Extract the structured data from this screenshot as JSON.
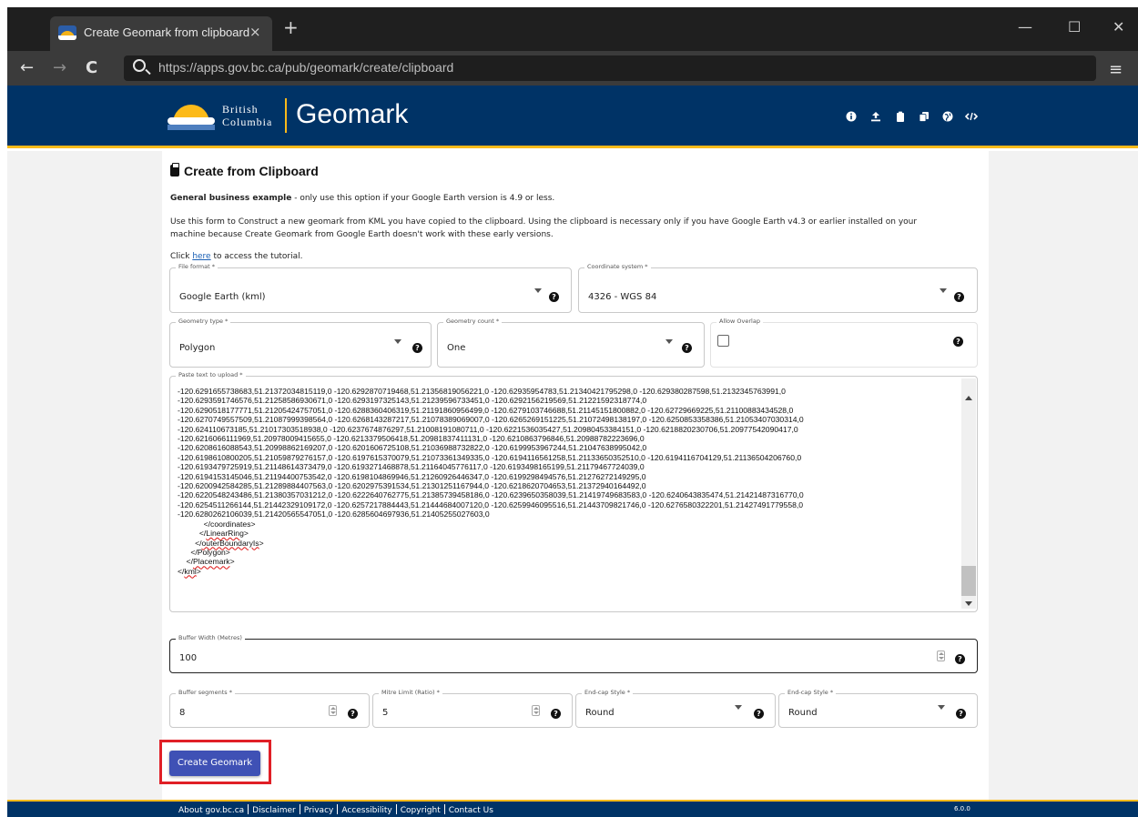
{
  "browser": {
    "tab_title": "Create Geomark from clipboard",
    "tab_close": "×",
    "new_tab": "+",
    "url": "https://apps.gov.bc.ca/pub/geomark/create/clipboard",
    "back": "←",
    "forward": "→",
    "reload": "C",
    "minimize": "—",
    "maximize": "☐",
    "close": "✕",
    "menu": "≡"
  },
  "header": {
    "logo_line1": "British",
    "logo_line2": "Columbia",
    "site_title": "Geomark",
    "icons": [
      "info-icon",
      "upload-icon",
      "clipboard-icon",
      "copy-icon",
      "globe-icon",
      "code-icon"
    ]
  },
  "page": {
    "title": "Create from Clipboard",
    "intro_bold": "General business example",
    "intro_rest": " - only use this option if your Google Earth version is 4.9 or less.",
    "para2_line1": "Use this form to Construct a new geomark from KML you have copied to the clipboard. Using the clipboard is necessary only if you have Google Earth v4.3 or earlier installed on your",
    "para2_line2": "machine because Create Geomark from Google Earth doesn't work with these early versions.",
    "tutorial_pre": "Click ",
    "tutorial_link": "here",
    "tutorial_post": " to access the tutorial."
  },
  "form": {
    "file_format": {
      "label": "File format *",
      "value": "Google Earth (kml)"
    },
    "coordinate_system": {
      "label": "Coordinate system *",
      "value": "4326 - WGS 84"
    },
    "geometry_type": {
      "label": "Geometry type *",
      "value": "Polygon"
    },
    "geometry_count": {
      "label": "Geometry count *",
      "value": "One"
    },
    "allow_overlap": {
      "label": "Allow Overlap"
    },
    "paste": {
      "label": "Paste text to upload *",
      "lines": [
        "-120.6291655738683,51.21372034815119,0 -120.6292870719468,51.21356819056221,0 -120.62935954783,51.21340421795298,0 -120.629380287598,51.2132345763991,0",
        "-120.6293591746576,51.21258586930671,0 -120.6293197325143,51.21239596733451,0 -120.6292156219569,51.21221592318774,0",
        "-120.6290518177771,51.21205424757051,0 -120.6288360406319,51.21191860956499,0 -120.6279103746688,51.21145151800882,0 -120.62729669225,51.21100883434528,0",
        "-120.6270749557509,51.21087999398564,0 -120.6268143287217,51.21078389069007,0 -120.6265269151225,51.21072498138197,0 -120.6250853358386,51.21053407030314,0",
        "-120.624110673185,51.21017303518938,0 -120.6237674876297,51.21008191080711,0 -120.6221536035427,51.20980453384151,0 -120.6218820230706,51.20977542090417,0",
        "-120.6216066111969,51.20978009415655,0 -120.6213379506418,51.20981837411131,0 -120.6210863796846,51.20988782223696,0",
        "-120.6208616088543,51.20998862169207,0 -120.6201606725108,51.21036988732822,0 -120.6199953967244,51.21047638995042,0",
        "-120.6198610800205,51.21059879276157,0 -120.6197615370079,51.21073361349335,0 -120.6194116561258,51.21133650352510,0 -120.6194116704129,51.21136504206760,0",
        "-120.6193479725919,51.21148614373479,0 -120.6193271468878,51.21164045776117,0 -120.6193498165199,51.21179467724039,0",
        "-120.6194153145046,51.21194400753542,0 -120.6198104869946,51.21260926446347,0 -120.6199298494576,51.21276272149295,0",
        "-120.6200942584285,51.21289884407563,0 -120.6202975391534,51.21301251167944,0 -120.6218620704653,51.21372940164492,0",
        "-120.6220548243486,51.21380357031212,0 -120.6222640762775,51.21385739458186,0 -120.6239650358039,51.21419749683583,0 -120.6240643835474,51.21421487316770,0",
        "-120.6254511266144,51.21442329109172,0 -120.6257217884443,51.21444684007120,0 -120.6259946095516,51.21443709821746,0 -120.6276580322201,51.21427491779558,0",
        "-120.6280262106039,51.21420565547051,0 -120.6285604697936,51.21405255027603,0",
        "            </coordinates>",
        "          </LinearRing>",
        "        </outerBoundaryIs>",
        "      </Polygon>",
        "    </Placemark>",
        "</kml>"
      ]
    },
    "buffer_width": {
      "label": "Buffer Width (Metres)",
      "value": "100"
    },
    "buffer_segments": {
      "label": "Buffer segments *",
      "value": "8"
    },
    "mitre_limit": {
      "label": "Mitre Limit (Ratio) *",
      "value": "5"
    },
    "end_cap_style": {
      "label": "End-cap Style *",
      "value": "Round"
    },
    "join_style": {
      "label": "End-cap Style *",
      "value": "Round"
    },
    "help_glyph": "?",
    "submit_label": "Create Geomark"
  },
  "footer": {
    "links": [
      "About gov.bc.ca",
      "Disclaimer",
      "Privacy",
      "Accessibility",
      "Copyright",
      "Contact Us"
    ],
    "version": "6.0.0"
  },
  "colors": {
    "bc_blue": "#003366",
    "bc_gold": "#fcba19",
    "button": "#3f51b5",
    "highlight": "#e01f26"
  }
}
